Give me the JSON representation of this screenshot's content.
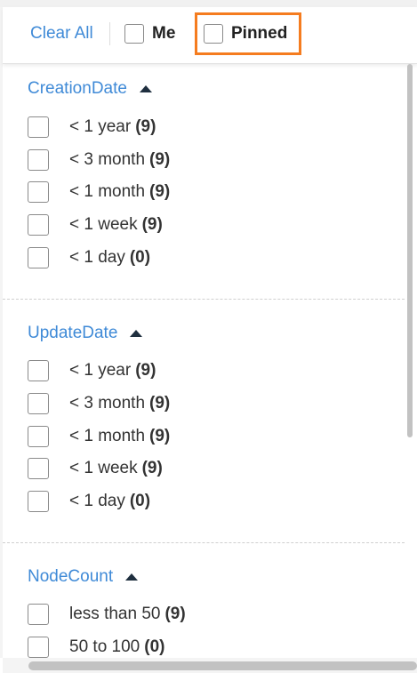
{
  "toolbar": {
    "clear_all": "Clear All",
    "me_label": "Me",
    "pinned_label": "Pinned",
    "highlight_color": "#f57c1f"
  },
  "colors": {
    "link": "#3f8ad7",
    "text": "#333333",
    "caret": "#1f2f3f"
  },
  "sections": [
    {
      "title": "CreationDate",
      "caret": "expanded",
      "options": [
        {
          "label": "< 1 year",
          "count": "(9)"
        },
        {
          "label": "< 3 month",
          "count": "(9)"
        },
        {
          "label": "< 1 month",
          "count": "(9)"
        },
        {
          "label": "< 1 week",
          "count": "(9)"
        },
        {
          "label": "< 1 day",
          "count": "(0)"
        }
      ]
    },
    {
      "title": "UpdateDate",
      "caret": "expanded",
      "options": [
        {
          "label": "< 1 year",
          "count": "(9)"
        },
        {
          "label": "< 3 month",
          "count": "(9)"
        },
        {
          "label": "< 1 month",
          "count": "(9)"
        },
        {
          "label": "< 1 week",
          "count": "(9)"
        },
        {
          "label": "< 1 day",
          "count": "(0)"
        }
      ]
    },
    {
      "title": "NodeCount",
      "caret": "expanded",
      "options": [
        {
          "label": "less than 50",
          "count": "(9)"
        },
        {
          "label": "50 to 100",
          "count": "(0)"
        }
      ]
    }
  ]
}
